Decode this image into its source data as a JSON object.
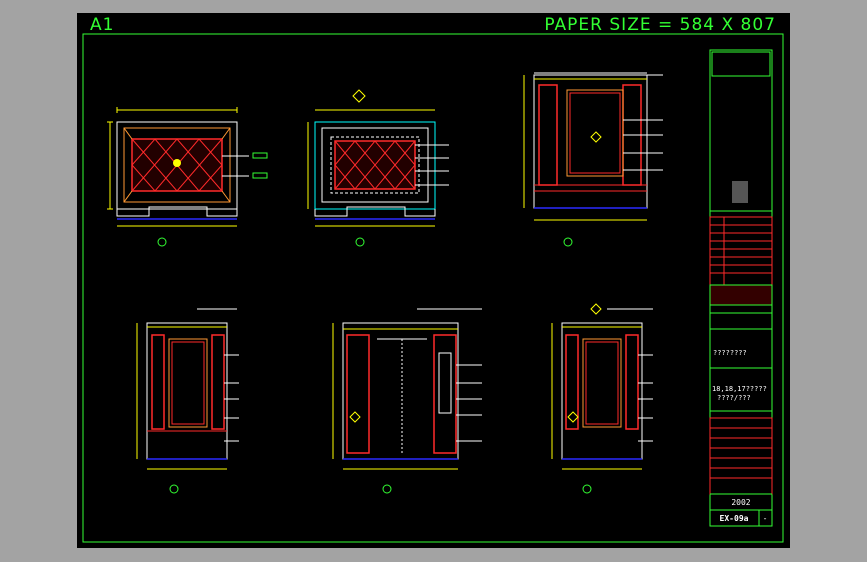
{
  "sheet": {
    "sheet_id": "A1",
    "paper_size": "PAPER SIZE = 584 X 807"
  },
  "title_block": {
    "sheet_number": "EX-09a",
    "revision": "-",
    "year": "2002",
    "scale_line": "18,18,17?????",
    "scale_line_2": "????/???",
    "notes": "????????"
  },
  "colors": {
    "frame": "#33ff33",
    "dimension": "#ffff00",
    "outline": "#ff2a2a",
    "leader": "#ffffff",
    "floor": "#2a2aff",
    "ceiling": "#00ffff"
  }
}
